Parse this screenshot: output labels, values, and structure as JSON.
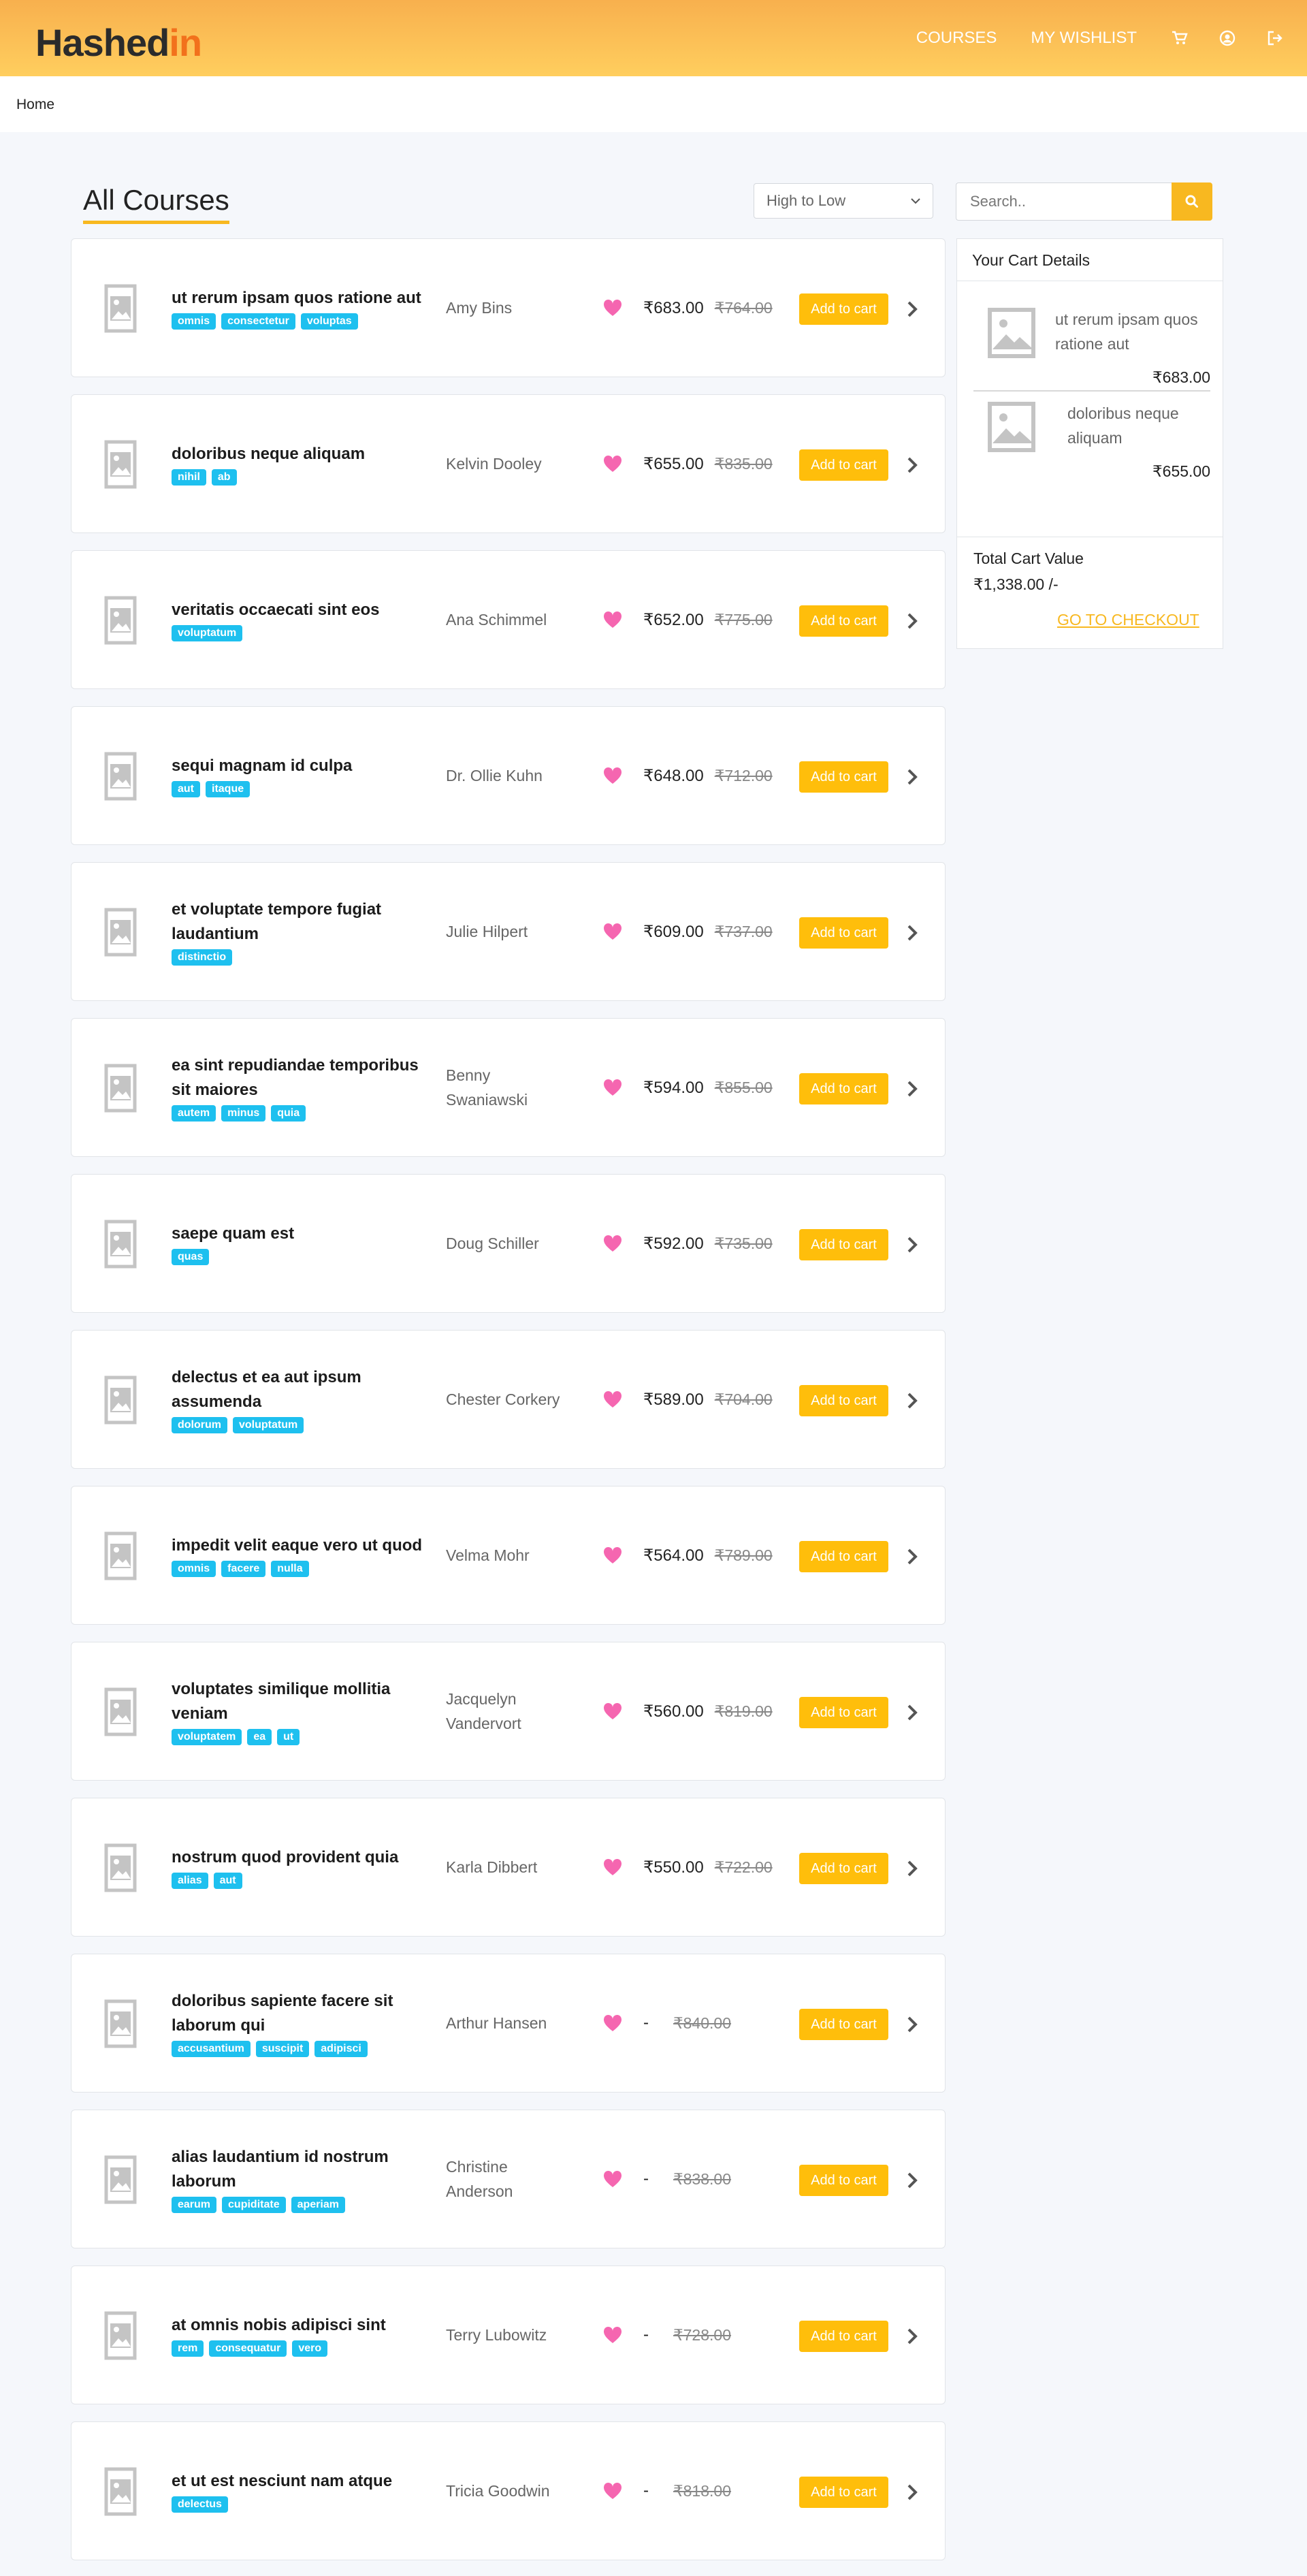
{
  "header": {
    "logo_main": "Hashed",
    "logo_accent": "in",
    "nav": {
      "courses": "COURSES",
      "wishlist": "MY WISHLIST"
    },
    "icons": [
      "cart-icon",
      "user-icon",
      "logout-icon"
    ]
  },
  "breadcrumb": {
    "home": "Home"
  },
  "main": {
    "title": "All Courses",
    "sort": {
      "selected": "High to Low"
    },
    "search": {
      "placeholder": "Search.."
    }
  },
  "courses": [
    {
      "title": "ut rerum ipsam quos ratione aut",
      "tags": [
        "omnis",
        "consectetur",
        "voluptas"
      ],
      "author": "Amy Bins",
      "price": "₹683.00",
      "old_price": "₹764.00",
      "cta": "Add to cart"
    },
    {
      "title": "doloribus neque aliquam",
      "tags": [
        "nihil",
        "ab"
      ],
      "author": "Kelvin Dooley",
      "price": "₹655.00",
      "old_price": "₹835.00",
      "cta": "Add to cart"
    },
    {
      "title": "veritatis occaecati sint eos",
      "tags": [
        "voluptatum"
      ],
      "author": "Ana Schimmel",
      "price": "₹652.00",
      "old_price": "₹775.00",
      "cta": "Add to cart"
    },
    {
      "title": "sequi magnam id culpa",
      "tags": [
        "aut",
        "itaque"
      ],
      "author": "Dr. Ollie Kuhn",
      "price": "₹648.00",
      "old_price": "₹712.00",
      "cta": "Add to cart"
    },
    {
      "title": "et voluptate tempore fugiat laudantium",
      "tags": [
        "distinctio"
      ],
      "author": "Julie Hilpert",
      "price": "₹609.00",
      "old_price": "₹737.00",
      "cta": "Add to cart"
    },
    {
      "title": "ea sint repudiandae temporibus sit maiores",
      "tags": [
        "autem",
        "minus",
        "quia"
      ],
      "author": "Benny Swaniawski",
      "price": "₹594.00",
      "old_price": "₹855.00",
      "cta": "Add to cart"
    },
    {
      "title": "saepe quam est",
      "tags": [
        "quas"
      ],
      "author": "Doug Schiller",
      "price": "₹592.00",
      "old_price": "₹735.00",
      "cta": "Add to cart"
    },
    {
      "title": "delectus et ea aut ipsum assumenda",
      "tags": [
        "dolorum",
        "voluptatum"
      ],
      "author": "Chester Corkery",
      "price": "₹589.00",
      "old_price": "₹704.00",
      "cta": "Add to cart"
    },
    {
      "title": "impedit velit eaque vero ut quod",
      "tags": [
        "omnis",
        "facere",
        "nulla"
      ],
      "author": "Velma Mohr",
      "price": "₹564.00",
      "old_price": "₹789.00",
      "cta": "Add to cart"
    },
    {
      "title": "voluptates similique mollitia veniam",
      "tags": [
        "voluptatem",
        "ea",
        "ut"
      ],
      "author": "Jacquelyn Vandervort",
      "price": "₹560.00",
      "old_price": "₹819.00",
      "cta": "Add to cart"
    },
    {
      "title": "nostrum quod provident quia",
      "tags": [
        "alias",
        "aut"
      ],
      "author": "Karla Dibbert",
      "price": "₹550.00",
      "old_price": "₹722.00",
      "cta": "Add to cart"
    },
    {
      "title": "doloribus sapiente facere sit laborum qui",
      "tags": [
        "accusantium",
        "suscipit",
        "adipisci"
      ],
      "author": "Arthur Hansen",
      "price": "-",
      "old_price": "₹840.00",
      "cta": "Add to cart"
    },
    {
      "title": "alias laudantium id nostrum laborum",
      "tags": [
        "earum",
        "cupiditate",
        "aperiam"
      ],
      "author": "Christine Anderson",
      "price": "-",
      "old_price": "₹838.00",
      "cta": "Add to cart"
    },
    {
      "title": "at omnis nobis adipisci sint",
      "tags": [
        "rem",
        "consequatur",
        "vero"
      ],
      "author": "Terry Lubowitz",
      "price": "-",
      "old_price": "₹728.00",
      "cta": "Add to cart"
    },
    {
      "title": "et ut est nesciunt nam atque",
      "tags": [
        "delectus"
      ],
      "author": "Tricia Goodwin",
      "price": "-",
      "old_price": "₹818.00",
      "cta": "Add to cart"
    }
  ],
  "cart": {
    "title": "Your Cart Details",
    "items": [
      {
        "title": "ut rerum ipsam quos ratione aut",
        "price": "₹683.00"
      },
      {
        "title": "doloribus neque aliquam",
        "price": "₹655.00"
      }
    ],
    "total_label": "Total Cart Value",
    "total_value": "₹1,338.00 /-",
    "checkout": "GO TO CHECKOUT"
  },
  "colors": {
    "accent": "#f8b820",
    "tag": "#1ec0ef",
    "heart": "#f566b0",
    "button": "#ffbe0b",
    "logo_accent": "#f2711c"
  }
}
